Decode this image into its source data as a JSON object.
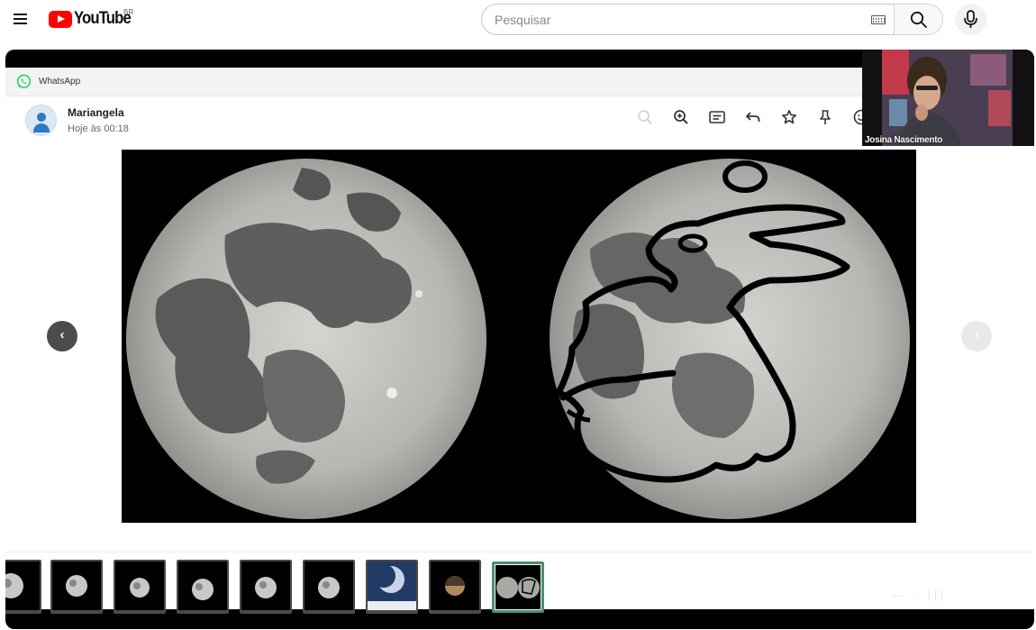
{
  "youtube": {
    "logo_text": "YouTube",
    "country_code": "BR",
    "search_placeholder": "Pesquisar",
    "brand_color": "#ff0000"
  },
  "whatsapp": {
    "app_title": "WhatsApp",
    "brand_color": "#25d366",
    "contact": {
      "name": "Mariangela",
      "time": "Hoje às 00:18"
    },
    "toolbar_icons": [
      "zoom-out-icon",
      "zoom-in-icon",
      "caption-icon",
      "reply-icon",
      "star-icon",
      "pin-icon",
      "emoji-icon"
    ],
    "nav": {
      "prev": "‹",
      "next": "›"
    },
    "thumbnails": [
      {
        "type": "full-moon",
        "partial": true
      },
      {
        "type": "full-moon"
      },
      {
        "type": "full-moon"
      },
      {
        "type": "full-moon"
      },
      {
        "type": "full-moon"
      },
      {
        "type": "full-moon"
      },
      {
        "type": "gibbous-blue"
      },
      {
        "type": "eclipse"
      },
      {
        "type": "moon-rabbit",
        "selected": true
      }
    ]
  },
  "webcam": {
    "presenter_name": "Josina Nascimento"
  }
}
